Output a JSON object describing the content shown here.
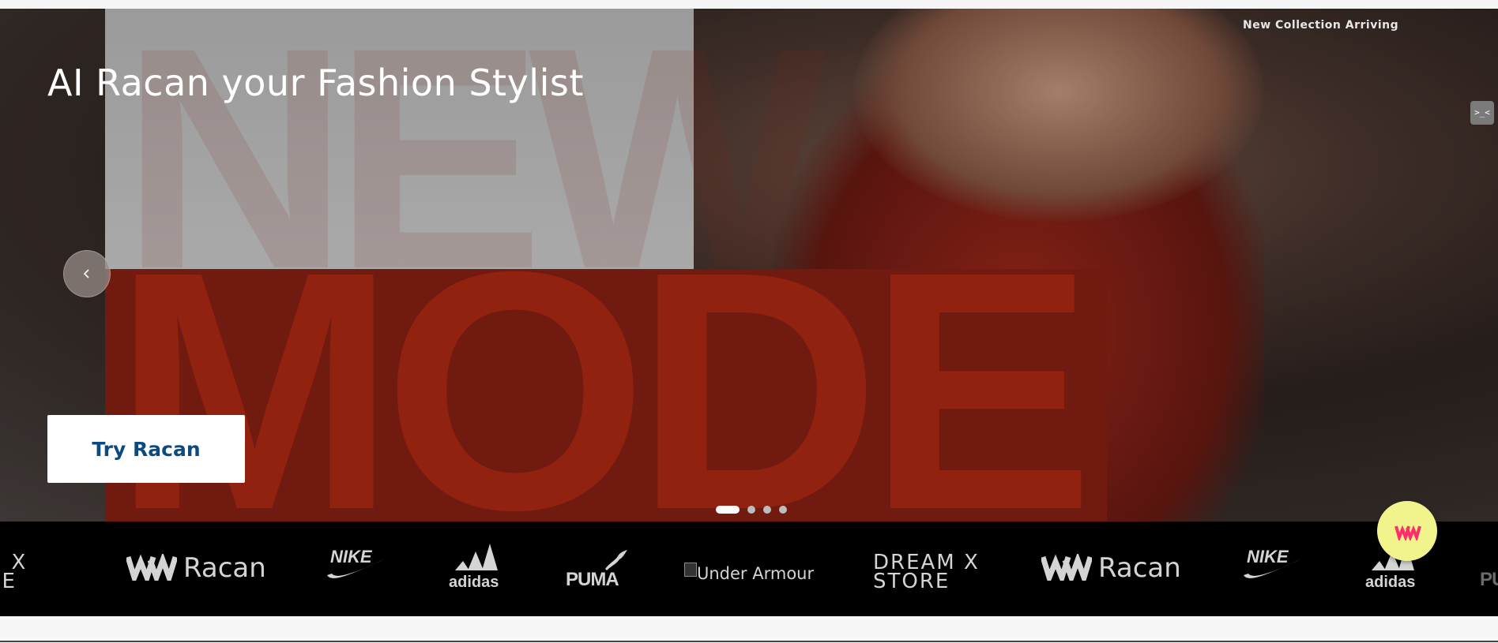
{
  "hero": {
    "title": "AI Racan your Fashion Stylist",
    "collection_label": "New Collection Arriving",
    "poster_text_top": "NEW",
    "poster_text_bottom": "MODE",
    "cta_label": "Try Racan",
    "extension_badge": ">_<",
    "prev_icon": "chevron-left-icon",
    "slides_total": 4,
    "active_slide": 1
  },
  "brands": {
    "partial_left": "AM X\nORE",
    "racan_1": "Racan",
    "nike_1": "NIKE",
    "adidas_1": "adidas",
    "puma": "PUMA",
    "under_armour_alt": "Under Armour",
    "dream_store": "DREAM X\nSTORE",
    "racan_2": "Racan",
    "nike_2": "NIKE",
    "adidas_2": "adidas",
    "partial_right": "PU"
  },
  "chat": {
    "icon": "racan-logo-icon"
  },
  "colors": {
    "brand_bar": "#000000",
    "cta_text": "#0d4a82",
    "chat_bg": "#f1f48c",
    "chat_logo": "#ff2d6b",
    "poster_red": "#b32a14"
  }
}
